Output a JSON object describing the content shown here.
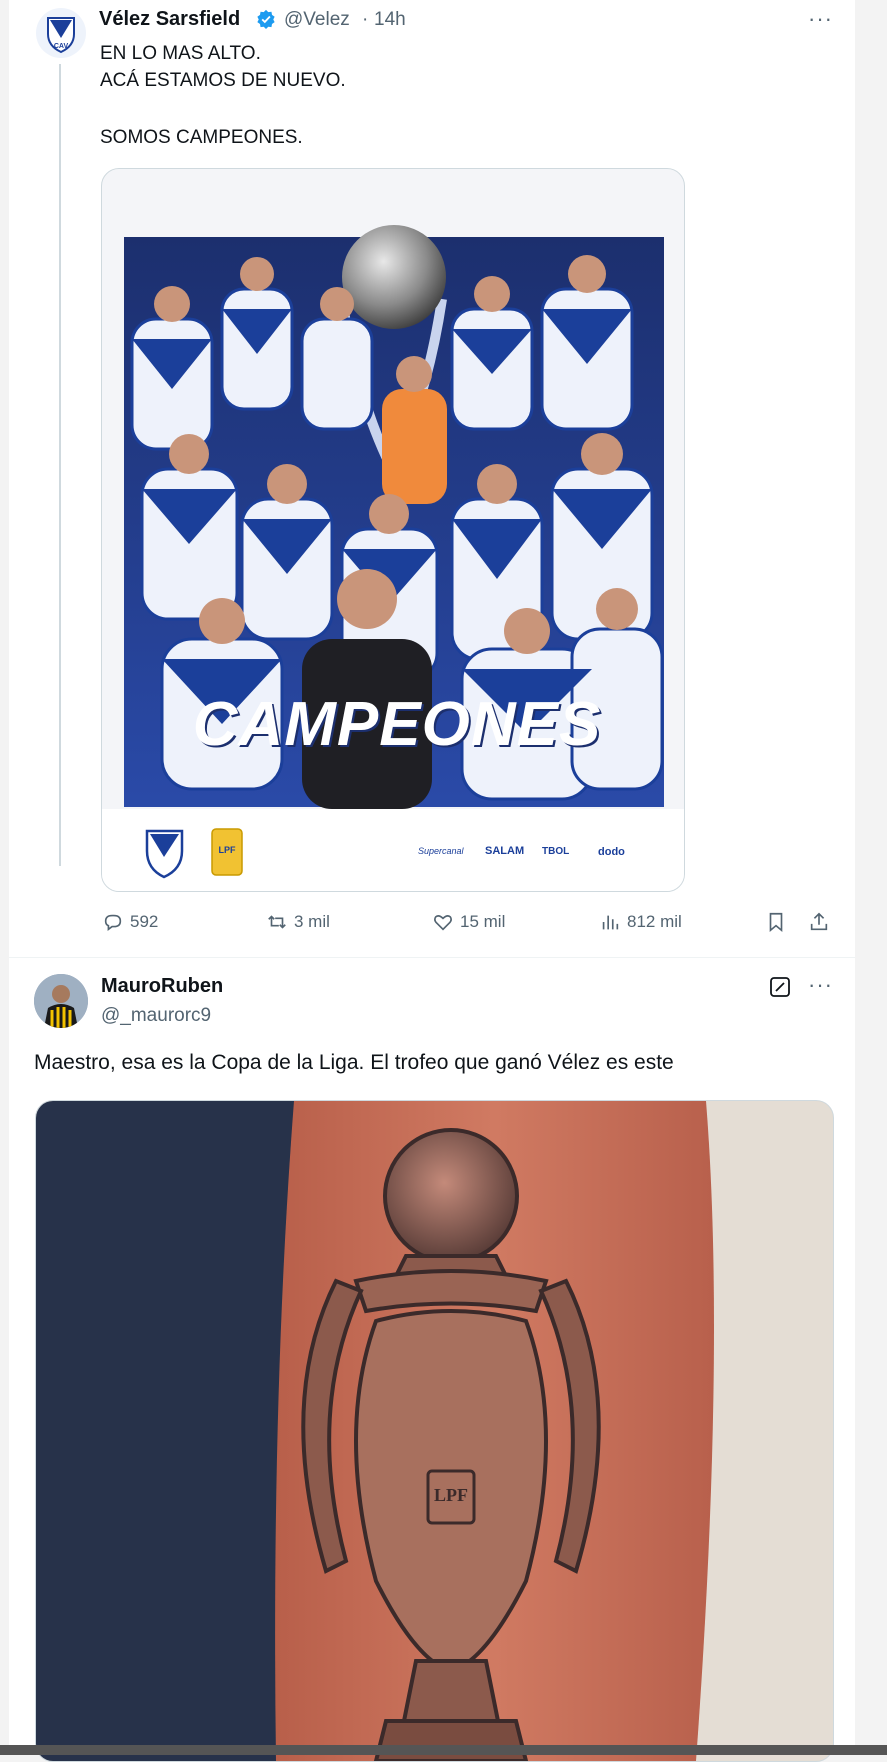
{
  "tweet1": {
    "author_name": "Vélez Sarsfield",
    "handle": "@Velez",
    "separator": "·",
    "time": "14h",
    "text_line1": "EN LO MAS ALTO.",
    "text_line2": "ACÁ ESTAMOS DE NUEVO.",
    "text_line3": "SOMOS CAMPEONES.",
    "image_banner": "CAMPEONES",
    "image_sponsor1": "Supercanal",
    "image_sponsor2": "SALAM",
    "image_sponsor3": "TBOL",
    "image_sponsor4": "dodo",
    "image_badge": "LPF",
    "replies": "592",
    "reposts": "3 mil",
    "likes": "15 mil",
    "views": "812 mil",
    "verified_icon": "verified-badge-icon",
    "more_icon": "more-icon"
  },
  "tweet2": {
    "author_name": "MauroRuben",
    "handle": "@_maurorc9",
    "text": "Maestro, esa es la Copa de la Liga. El trofeo que ganó Vélez es este",
    "trophy_badge": "LPF",
    "edit_icon": "grok-icon",
    "more_icon": "more-icon"
  },
  "colors": {
    "accent": "#1d9bf0",
    "velez_blue": "#1b3f9a",
    "text": "#0f1419",
    "muted": "#536471"
  }
}
